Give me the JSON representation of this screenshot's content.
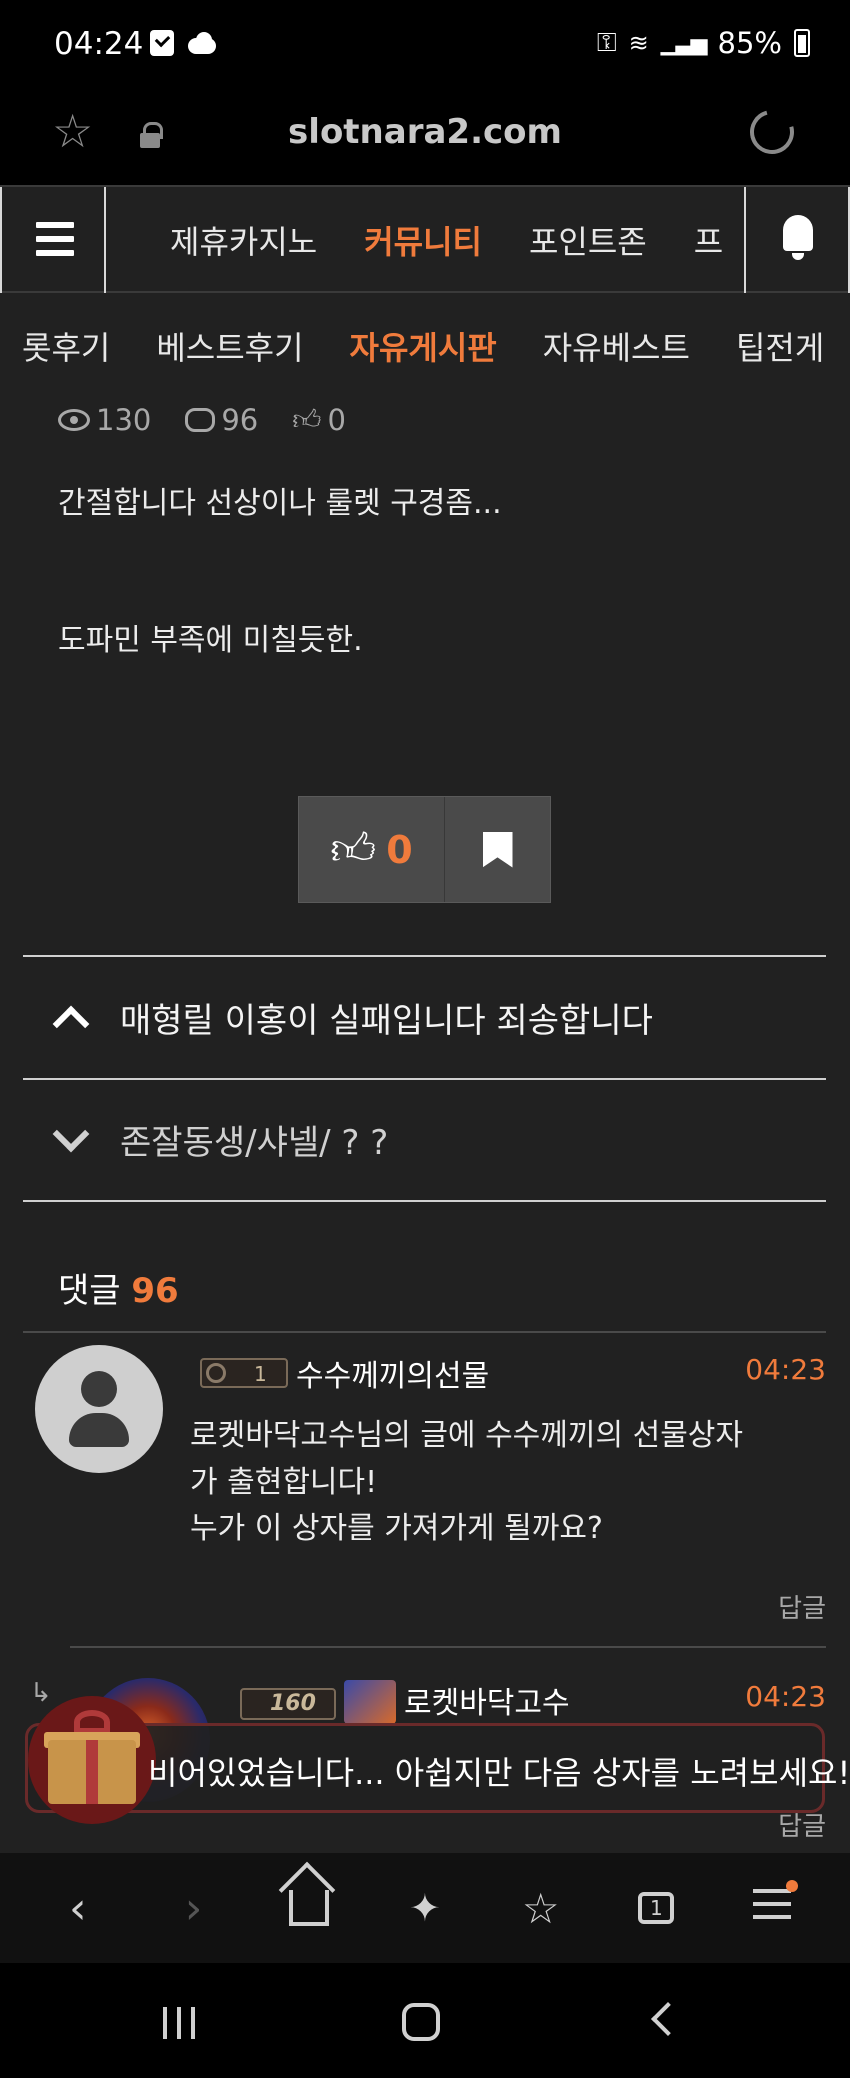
{
  "status_bar": {
    "time": "04:24",
    "battery": "85%"
  },
  "url_bar": {
    "url": "slotnara2.com"
  },
  "site_nav": {
    "items": [
      "제휴카지노",
      "커뮤니티",
      "포인트존",
      "프"
    ],
    "active_index": 1
  },
  "sub_nav": {
    "items": [
      "롯후기",
      "베스트후기",
      "자유게시판",
      "자유베스트",
      "팁전게"
    ],
    "active_index": 2
  },
  "post": {
    "views": "130",
    "comments": "96",
    "likes": "0",
    "body": [
      "간절합니다 선상이나 룰렛 구경좀...",
      "도파민 부족에 미칠듯한."
    ],
    "vote_count": "0"
  },
  "post_nav": {
    "prev_title": "매형릴 이홍이 실패입니다 죄송합니다",
    "next_title": "존잘동생/샤넬/ ? ?"
  },
  "comments_section": {
    "label": "댓글",
    "count": "96"
  },
  "comments": [
    {
      "level": "1",
      "author": "수수께끼의선물",
      "time": "04:23",
      "text_lines": [
        "로켓바닥고수님의 글에 수수께끼의 선물상자",
        "가 출현합니다!",
        "누가 이 상자를 가져가게 될까요?"
      ],
      "reply_label": "답글"
    },
    {
      "rank": "160",
      "author": "로켓바닥고수",
      "time": "04:23",
      "reply_label": "답글"
    }
  ],
  "toast": {
    "text": "비어있었습니다... 아쉽지만 다음 상자를 노려보세요!"
  },
  "colors": {
    "accent": "#f07b3c",
    "background": "#212121"
  }
}
